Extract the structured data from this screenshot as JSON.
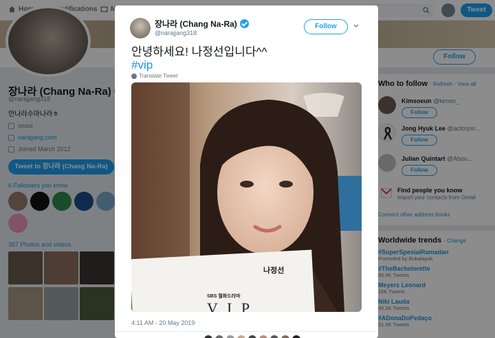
{
  "nav": {
    "home": "Home",
    "notifications": "Notifications",
    "messages_partial": "M",
    "tweet_button": "Tweet"
  },
  "profile": {
    "name": "장나라 (Chang Na-Ra)",
    "handle": "@narajjang318",
    "bio": "안나라수마나라ㅎ",
    "location": "seoul",
    "website": "narajjang.com",
    "joined": "Joined March 2012",
    "tweet_to": "Tweet to 장나라 (Chang Na-Ra)",
    "followers_you_know": "6 Followers you know",
    "photos_videos": "387 Photos and videos",
    "follow_label": "Follow"
  },
  "modal": {
    "name": "장나라 (Chang Na-Ra)",
    "handle": "@narajjang318",
    "follow_label": "Follow",
    "text": "안녕하세요! 나정선입니다^^",
    "hashtag": "#vip",
    "translate": "Translate Tweet",
    "photo_caption": "나정선",
    "photo_brand": "SBS",
    "photo_sub": "월화드라마",
    "photo_title": "V I P",
    "timestamp": "4:11 AM - 20 May 2019"
  },
  "who_to_follow": {
    "title": "Who to follow",
    "refresh": "· Refresh · View all",
    "users": [
      {
        "name": "Kimsoeun",
        "handle": "@kimso_",
        "button": "Follow"
      },
      {
        "name": "Jong Hyuk Lee",
        "handle": "@actorjon...",
        "button": "Follow"
      },
      {
        "name": "Julian Quintart",
        "handle": "@Abou...",
        "button": "Follow"
      }
    ],
    "find_people_title": "Find people you know",
    "find_people_sub": "Import your contacts from Gmail",
    "connect": "Connect other address books"
  },
  "trends": {
    "title": "Worldwide trends",
    "change": "· Change",
    "items": [
      {
        "name": "#SuperSpesialRamadan",
        "sub": "Promoted by Bukalapak"
      },
      {
        "name": "#TheBachelorette",
        "sub": "55.9K Tweets"
      },
      {
        "name": "Meyers Leonard",
        "sub": "16K Tweets"
      },
      {
        "name": "Niki Lauda",
        "sub": "56.2K Tweets"
      },
      {
        "name": "#ADonaDoPedaço",
        "sub": "51.5K Tweets"
      }
    ]
  },
  "colors": {
    "accent": "#1da1f2",
    "link": "#1b95e0",
    "text_muted": "#657786"
  }
}
